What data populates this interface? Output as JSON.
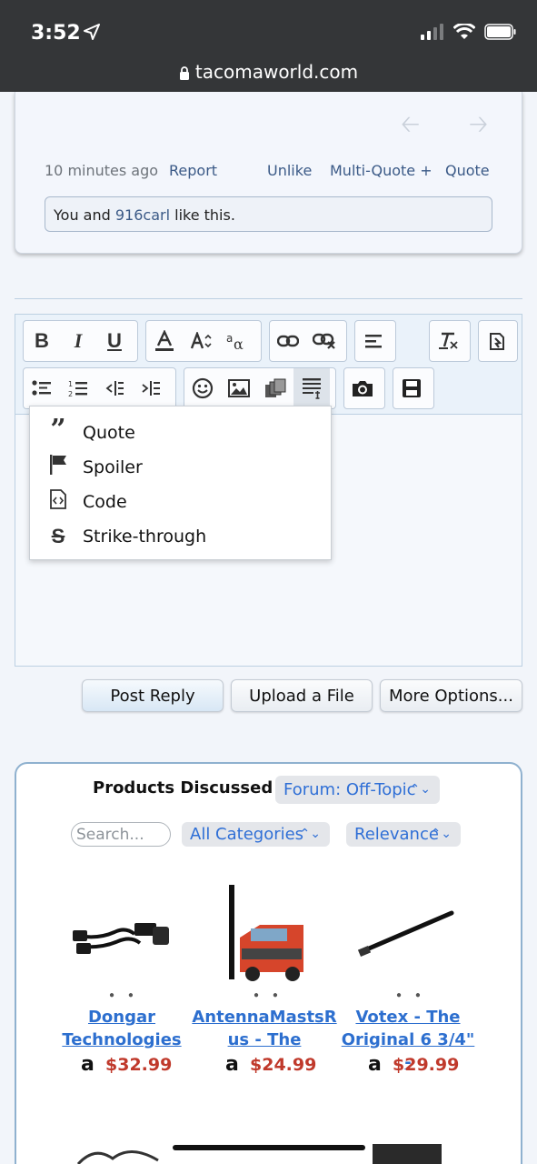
{
  "status_bar": {
    "time": "3:52",
    "url": "tacomaworld.com"
  },
  "post": {
    "timestamp": "10 minutes ago",
    "report": "Report",
    "unlike": "Unlike",
    "multi_quote": "Multi-Quote +",
    "quote": "Quote",
    "likes_prefix": "You and ",
    "likes_user": "916carl",
    "likes_suffix": " like this."
  },
  "toolbar": {
    "bold": "B",
    "italic": "I",
    "underline": "U"
  },
  "dropdown": {
    "items": [
      {
        "label": "Quote",
        "icon": "quote-icon"
      },
      {
        "label": "Spoiler",
        "icon": "flag-icon"
      },
      {
        "label": "Code",
        "icon": "code-file-icon"
      },
      {
        "label": "Strike-through",
        "icon": "strikethrough-icon"
      }
    ]
  },
  "buttons": {
    "post_reply": "Post Reply",
    "upload_file": "Upload a File",
    "more_options": "More Options..."
  },
  "products": {
    "title": "Products Discussed in",
    "forum_select": "Forum: Off-Topic",
    "search_placeholder": "Search...",
    "category_select": "All Categories",
    "sort_select": "Relevance",
    "items": [
      {
        "name_line1": "Dongar",
        "name_line2": "Technologies",
        "price": "$32.99"
      },
      {
        "name_line1": "AntennaMastsR",
        "name_line2": "us - The",
        "price": "$24.99"
      },
      {
        "name_line1": "Votex - The",
        "name_line2": "Original 6 3/4\" -",
        "price": "$29.99"
      }
    ],
    "amazon_glyph": "a"
  }
}
